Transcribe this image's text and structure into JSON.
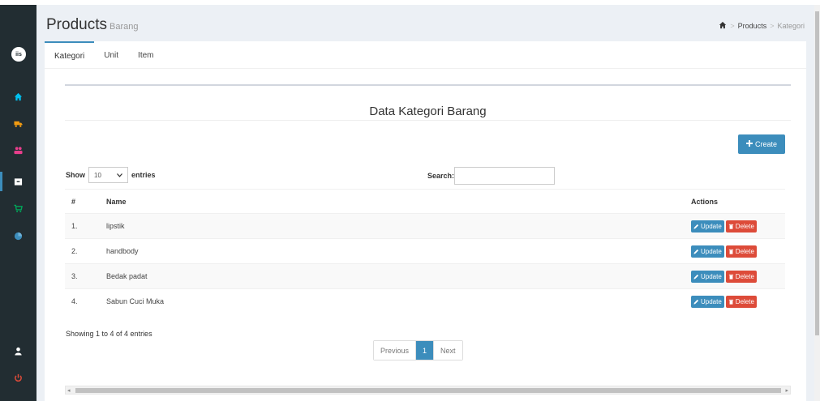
{
  "header": {
    "title": "Products",
    "subtitle": "Barang",
    "breadcrumb": [
      "Products",
      "Kategori"
    ]
  },
  "sidebar": {
    "logo_text": "iis",
    "items": [
      {
        "icon": "home-icon",
        "color": "#00c0ef"
      },
      {
        "icon": "truck-icon",
        "color": "#f39c12"
      },
      {
        "icon": "users-icon",
        "color": "#e83e8c"
      },
      {
        "icon": "archive-icon",
        "color": "#ffffff"
      },
      {
        "icon": "cart-icon",
        "color": "#00a65a"
      },
      {
        "icon": "chart-pie-icon",
        "color": "#3c8dbc"
      },
      {
        "icon": "user-icon",
        "color": "#ffffff"
      },
      {
        "icon": "power-icon",
        "color": "#dd4b39"
      }
    ]
  },
  "tabs": [
    "Kategori",
    "Unit",
    "Item"
  ],
  "box": {
    "title": "Data Kategori Barang",
    "create_label": "Create"
  },
  "table_controls": {
    "show_label": "Show",
    "page_size": "10",
    "entries_label": "entries",
    "search_label": "Search:",
    "search_value": ""
  },
  "table": {
    "headers": [
      "#",
      "Name",
      "Actions"
    ],
    "rows": [
      {
        "num": "1.",
        "name": "lipstik"
      },
      {
        "num": "2.",
        "name": "handbody"
      },
      {
        "num": "3.",
        "name": "Bedak padat"
      },
      {
        "num": "4.",
        "name": "Sabun Cuci Muka"
      }
    ],
    "update_label": "Update",
    "delete_label": "Delete"
  },
  "footer": {
    "info": "Showing 1 to 4 of 4 entries",
    "previous": "Previous",
    "current_page": "1",
    "next": "Next"
  },
  "colors": {
    "accent": "#3c8dbc",
    "danger": "#dd4b39",
    "sidebar_bg": "#222d32"
  }
}
